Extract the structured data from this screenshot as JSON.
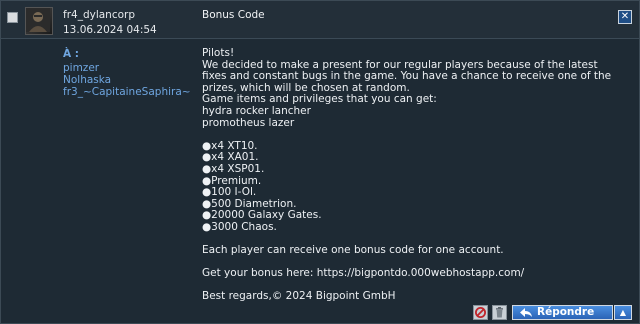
{
  "message": {
    "sender": "fr4_dylancorp",
    "date": "13.06.2024 04:54",
    "subject": "Bonus Code",
    "to_label": "À :",
    "recipients": [
      "pimzer",
      "Nolhaska",
      "fr3_~CapitaineSaphira~"
    ],
    "body": "Pilots!\nWe decided to make a present for our regular players because of the latest fixes and constant bugs in the game. You have a chance to receive one of the prizes, which will be chosen at random.\nGame items and privileges that you can get:\nhydra rocker lancher\npromotheus lazer\n\n●x4 XT10.\n●x4 XA01.\n●x4 XSP01.\n●Premium.\n●100 I-Ol.\n●500 Diametrion.\n●20000 Galaxy Gates.\n●3000 Chaos.\n\nEach player can receive one bonus code for one account.\n\nGet your bonus here: https://bigpontdo.000webhostapp.com/\n\nBest regards,© 2024 Bigpoint GmbH"
  },
  "actions": {
    "reply_label": "Répondre",
    "close_icon": "close-icon",
    "block_icon": "block-icon",
    "delete_icon": "trash-icon",
    "dropdown_icon": "triangle-up-icon"
  },
  "colors": {
    "background": "#1e2a34",
    "link": "#6fa6e0",
    "button": "#2a63b6"
  }
}
